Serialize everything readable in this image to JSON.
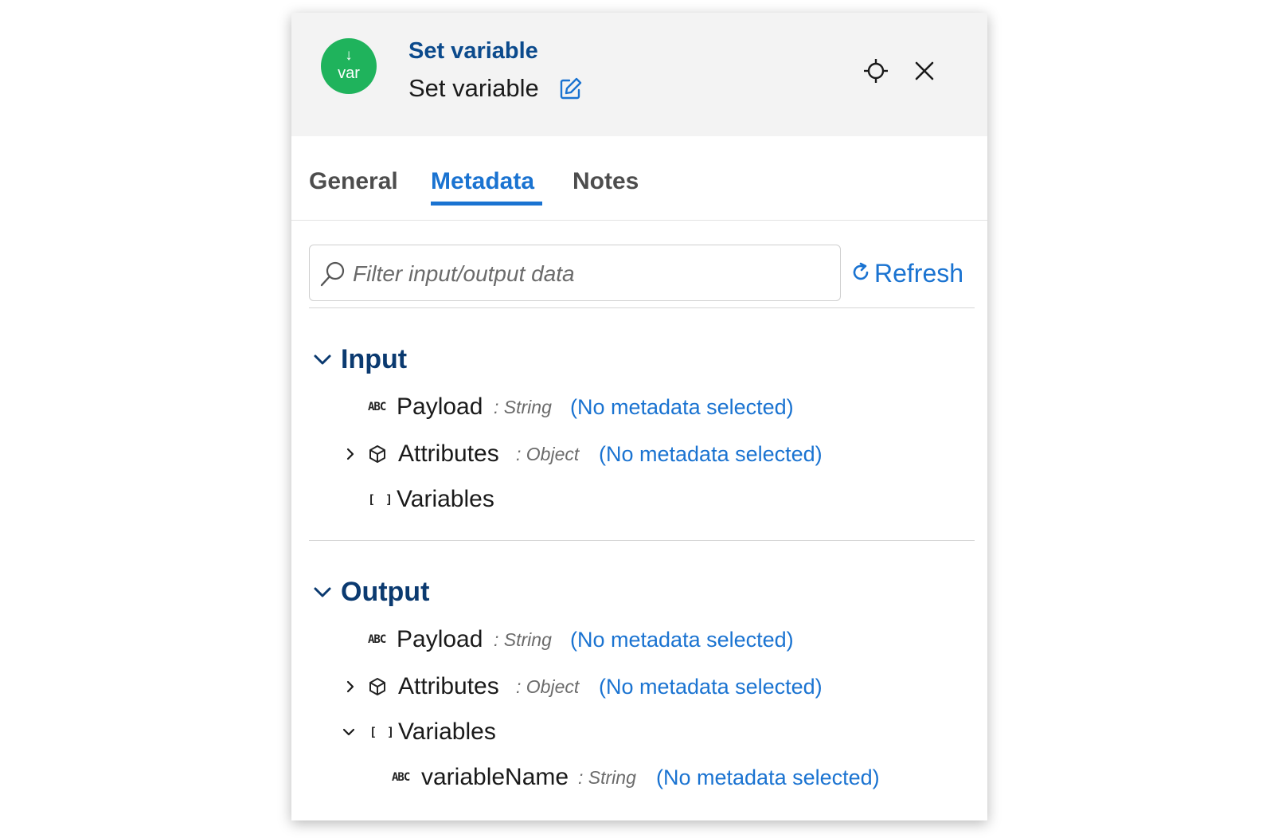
{
  "header": {
    "app_icon_label": "var",
    "app_icon_arrow": "↓",
    "title": "Set variable",
    "subtitle": "Set variable"
  },
  "tabs": [
    {
      "label": "General",
      "active": false
    },
    {
      "label": "Metadata",
      "active": true
    },
    {
      "label": "Notes",
      "active": false
    }
  ],
  "search": {
    "placeholder": "Filter input/output data",
    "value": ""
  },
  "refresh_label": "Refresh",
  "sections": {
    "input": {
      "title": "Input",
      "rows": [
        {
          "name": "Payload",
          "type": ": String",
          "meta": "(No metadata selected)"
        },
        {
          "name": "Attributes",
          "type": ": Object",
          "meta": "(No metadata selected)"
        },
        {
          "name": "Variables"
        }
      ]
    },
    "output": {
      "title": "Output",
      "rows": [
        {
          "name": "Payload",
          "type": ": String",
          "meta": "(No metadata selected)"
        },
        {
          "name": "Attributes",
          "type": ": Object",
          "meta": "(No metadata selected)"
        },
        {
          "name": "Variables"
        },
        {
          "name": "variableName",
          "type": ": String",
          "meta": "(No metadata selected)"
        }
      ]
    }
  },
  "icons": {
    "abc": "ABC",
    "brackets": "[ ]"
  },
  "colors": {
    "accent": "#1a73d1",
    "title_blue": "#0b4a8c",
    "section_blue": "#0b3a70",
    "app_icon_green": "#1fb35c",
    "header_bg": "#f3f3f3"
  }
}
